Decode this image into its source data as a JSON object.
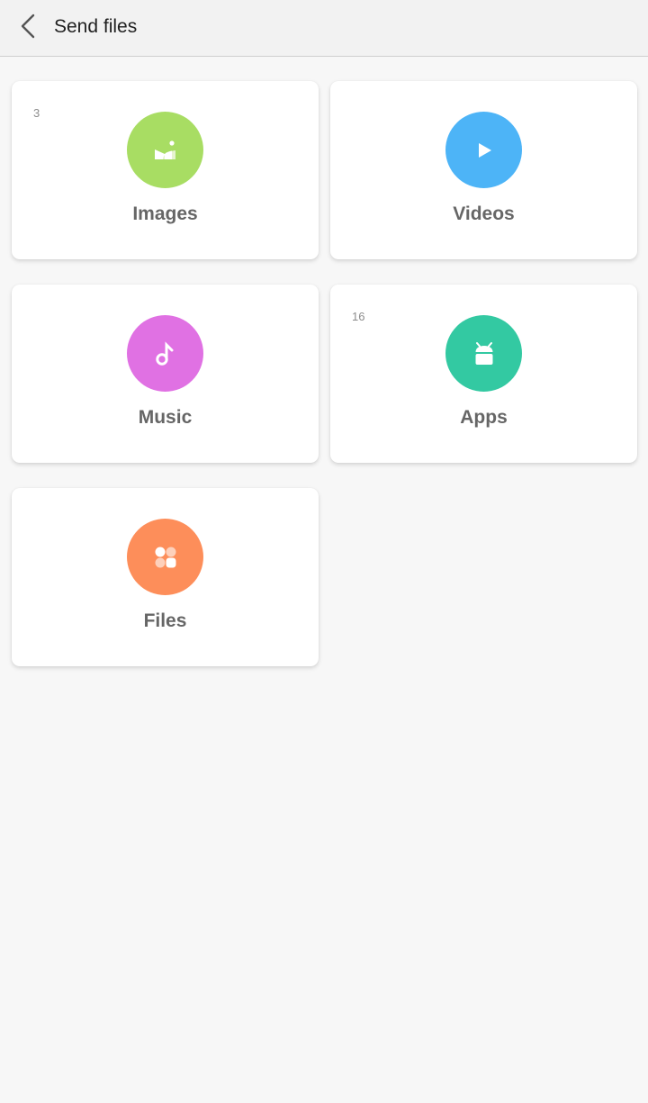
{
  "header": {
    "title": "Send files",
    "back_icon": "chevron-left-icon"
  },
  "categories": [
    {
      "key": "images",
      "label": "Images",
      "count": "3",
      "color": "#a8dd63",
      "icon": "image-icon"
    },
    {
      "key": "videos",
      "label": "Videos",
      "count": "",
      "color": "#4db4f7",
      "icon": "play-icon"
    },
    {
      "key": "music",
      "label": "Music",
      "count": "",
      "color": "#e071e3",
      "icon": "music-note-icon"
    },
    {
      "key": "apps",
      "label": "Apps",
      "count": "16",
      "color": "#33c9a2",
      "icon": "android-icon"
    },
    {
      "key": "files",
      "label": "Files",
      "count": "",
      "color": "#fd8e5a",
      "icon": "folder-grid-icon"
    }
  ]
}
